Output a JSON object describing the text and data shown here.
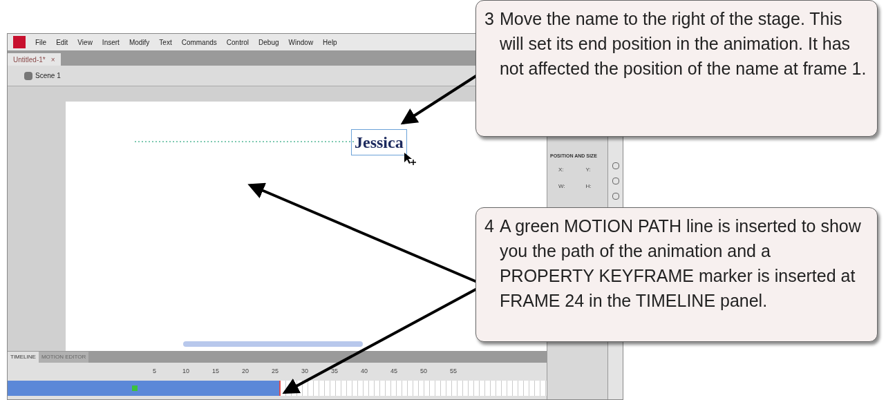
{
  "menu": [
    "File",
    "Edit",
    "View",
    "Insert",
    "Modify",
    "Text",
    "Commands",
    "Control",
    "Debug",
    "Window",
    "Help"
  ],
  "document_tab": {
    "title": "Untitled-1*",
    "close": "×"
  },
  "breadcrumb": "Scene 1",
  "stage": {
    "object_text": "Jessica"
  },
  "properties": {
    "section": "POSITION AND SIZE",
    "fields": [
      "X:",
      "Y:",
      "W:",
      "H:"
    ]
  },
  "timeline": {
    "tabs": [
      {
        "label": "TIMELINE",
        "selected": true
      },
      {
        "label": "MOTION EDITOR",
        "selected": false
      }
    ],
    "frame_numbers": [
      "5",
      "10",
      "15",
      "20",
      "25",
      "30",
      "35",
      "40",
      "45",
      "50",
      "55"
    ]
  },
  "callouts": [
    {
      "number": "3",
      "text": "Move the name to the right of the stage.  This will set its end position in the animation.  It has not affected the position of the name at frame 1."
    },
    {
      "number": "4",
      "text": "A green MOTION PATH line is inserted to show you the path of the animation and a PROPERTY KEYFRAME marker is inserted at FRAME 24 in the TIMELINE panel."
    }
  ]
}
